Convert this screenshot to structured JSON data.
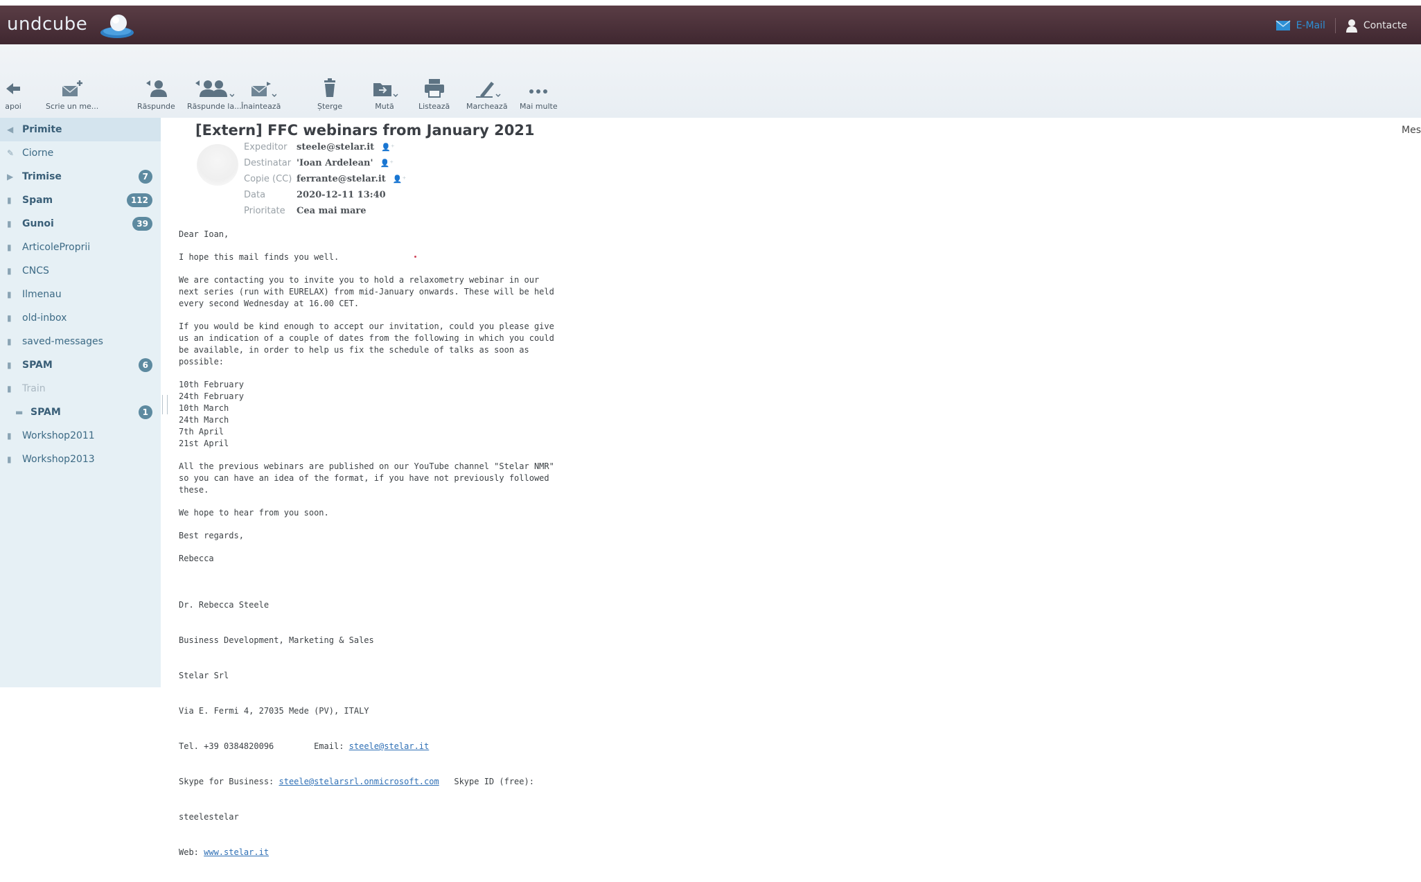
{
  "header": {
    "logo_text": "undcube",
    "email_label": "E-Mail",
    "contacts_label": "Contacte"
  },
  "toolbar": [
    {
      "name": "back-button",
      "label": "apoi",
      "icon": "arrow-left-icon"
    },
    {
      "name": "compose-button",
      "label": "Scrie un me...",
      "icon": "compose-mail-icon"
    },
    {
      "name": "reply-button",
      "label": "Răspunde",
      "icon": "reply-icon"
    },
    {
      "name": "reply-all-button",
      "label": "Răspunde la...",
      "icon": "reply-all-icon"
    },
    {
      "name": "forward-button",
      "label": "Înaintează",
      "icon": "forward-icon"
    },
    {
      "name": "delete-button",
      "label": "Șterge",
      "icon": "trash-icon"
    },
    {
      "name": "move-button",
      "label": "Mută",
      "icon": "folder-move-icon"
    },
    {
      "name": "print-button",
      "label": "Listează",
      "icon": "printer-icon"
    },
    {
      "name": "mark-button",
      "label": "Marchează",
      "icon": "pencil-icon"
    },
    {
      "name": "more-button",
      "label": "Mai multe",
      "icon": "more-dots-icon"
    }
  ],
  "folders": [
    {
      "name": "Primite",
      "count": "",
      "bold": true,
      "selected": true,
      "dim": false
    },
    {
      "name": "Ciorne",
      "count": "",
      "bold": false,
      "selected": false,
      "dim": false
    },
    {
      "name": "Trimise",
      "count": "7",
      "bold": true,
      "selected": false,
      "dim": false
    },
    {
      "name": "Spam",
      "count": "112",
      "bold": true,
      "selected": false,
      "dim": false
    },
    {
      "name": "Gunoi",
      "count": "39",
      "bold": true,
      "selected": false,
      "dim": false
    },
    {
      "name": "ArticoleProprii",
      "count": "",
      "bold": false,
      "selected": false,
      "dim": false
    },
    {
      "name": "CNCS",
      "count": "",
      "bold": false,
      "selected": false,
      "dim": false
    },
    {
      "name": "Ilmenau",
      "count": "",
      "bold": false,
      "selected": false,
      "dim": false
    },
    {
      "name": "old-inbox",
      "count": "",
      "bold": false,
      "selected": false,
      "dim": false
    },
    {
      "name": "saved-messages",
      "count": "",
      "bold": false,
      "selected": false,
      "dim": false
    },
    {
      "name": "SPAM",
      "count": "6",
      "bold": true,
      "selected": false,
      "dim": false
    },
    {
      "name": "Train",
      "count": "",
      "bold": false,
      "selected": false,
      "dim": true
    },
    {
      "name": "SPAM",
      "count": "1",
      "bold": true,
      "selected": false,
      "dim": false,
      "nested": true
    },
    {
      "name": "Workshop2011",
      "count": "",
      "bold": false,
      "selected": false,
      "dim": false
    },
    {
      "name": "Workshop2013",
      "count": "",
      "bold": false,
      "selected": false,
      "dim": false
    }
  ],
  "message": {
    "subject": "[Extern] FFC webinars from January 2021",
    "side_label": "Mes",
    "headers": [
      {
        "key": "Expeditor",
        "value": "steele@stelar.it",
        "add": true
      },
      {
        "key": "Destinatar",
        "value": "'Ioan Ardelean'",
        "add": true
      },
      {
        "key": "Copie (CC)",
        "value": "ferrante@stelar.it",
        "add": true
      },
      {
        "key": "Data",
        "value": "2020-12-11 13:40",
        "add": false
      },
      {
        "key": "Prioritate",
        "value": "Cea mai mare",
        "add": false
      }
    ],
    "greeting": "Dear Ioan,",
    "p1": "I hope this mail finds you well.",
    "p2": "We are contacting you to invite you to hold a relaxometry webinar in our\nnext series (run with EURELAX) from mid-January onwards. These will be held\nevery second Wednesday at 16.00 CET.",
    "p3": "If you would be kind enough to accept our invitation, could you please give\nus an indication of a couple of dates from the following in which you could\nbe available, in order to help us fix the schedule of talks as soon as\npossible:",
    "dates": "10th February\n24th February\n10th March\n24th March\n7th April\n21st April",
    "p4": "All the previous webinars are published on our YouTube channel \"Stelar NMR\"\nso you can have an idea of the format, if you have not previously followed\nthese.",
    "p5": "We hope to hear from you soon.",
    "p6": "Best regards,",
    "p7": "Rebecca",
    "sig": {
      "l1": "Dr. Rebecca Steele",
      "l2": "Business Development, Marketing & Sales",
      "l3": "Stelar Srl",
      "l4": "Via E. Fermi 4, 27035 Mede (PV), ITALY",
      "tel": "Tel. +39 0384820096",
      "email_prefix": "Email: ",
      "email": "steele@stelar.it",
      "skype_prefix": "Skype for Business: ",
      "skype_link": "steele@stelarsrl.onmicrosoft.com",
      "skype_id": "   Skype ID (free):",
      "skype_name": "steelestelar",
      "web_prefix": "Web: ",
      "web": "www.stelar.it"
    }
  }
}
